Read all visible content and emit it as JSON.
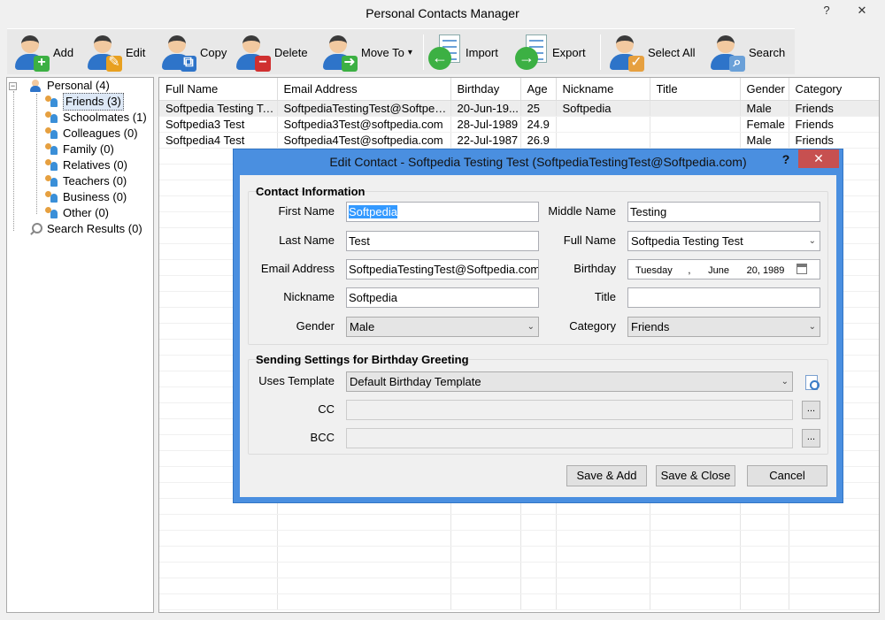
{
  "window": {
    "title": "Personal Contacts Manager",
    "help_glyph": "?",
    "close_glyph": "✕"
  },
  "toolbar": {
    "add": "Add",
    "edit": "Edit",
    "copy": "Copy",
    "delete": "Delete",
    "move_to": "Move To",
    "move_to_arrow": "▾",
    "import": "Import",
    "export": "Export",
    "select_all": "Select All",
    "search": "Search"
  },
  "tree": {
    "expander": "−",
    "root": "Personal (4)",
    "items": [
      "Friends (3)",
      "Schoolmates (1)",
      "Colleagues (0)",
      "Family (0)",
      "Relatives (0)",
      "Teachers (0)",
      "Business (0)",
      "Other (0)"
    ],
    "search_results": "Search Results (0)"
  },
  "grid": {
    "columns": [
      "Full Name",
      "Email Address",
      "Birthday",
      "Age",
      "Nickname",
      "Title",
      "Gender",
      "Category"
    ],
    "rows": [
      [
        "Softpedia  Testing  Test",
        "SoftpediaTestingTest@Softpedi...",
        "20-Jun-19...",
        "25",
        "Softpedia",
        "",
        "Male",
        "Friends"
      ],
      [
        "Softpedia3   Test",
        "Softpedia3Test@softpedia.com",
        "28-Jul-1989",
        "24.9",
        "",
        "",
        "Female",
        "Friends"
      ],
      [
        "Softpedia4   Test",
        "Softpedia4Test@softpedia.com",
        "22-Jul-1987",
        "26.9",
        "",
        "",
        "Male",
        "Friends"
      ]
    ]
  },
  "dialog": {
    "title": "Edit Contact - Softpedia Testing Test (SoftpediaTestingTest@Softpedia.com)",
    "help": "?",
    "close": "✕",
    "contact_section": "Contact Information",
    "labels": {
      "first_name": "First Name",
      "middle_name": "Middle Name",
      "last_name": "Last Name",
      "full_name": "Full Name",
      "email": "Email Address",
      "birthday": "Birthday",
      "nickname": "Nickname",
      "title": "Title",
      "gender": "Gender",
      "category": "Category"
    },
    "values": {
      "first_name": "Softpedia",
      "middle_name": "Testing",
      "last_name": "Test",
      "full_name": "Softpedia Testing Test",
      "email": "SoftpediaTestingTest@Softpedia.com",
      "birthday_weekday": "Tuesday",
      "birthday_sep": ",",
      "birthday_month": "June",
      "birthday_day_year": "20, 1989",
      "nickname": "Softpedia",
      "title": "",
      "gender": "Male",
      "category": "Friends"
    },
    "greeting_section": "Sending Settings for Birthday Greeting",
    "greeting_labels": {
      "uses_template": "Uses Template",
      "cc": "CC",
      "bcc": "BCC"
    },
    "greeting_values": {
      "template": "Default Birthday Template",
      "cc": "",
      "bcc": "",
      "browse": "..."
    },
    "buttons": {
      "save_add": "Save & Add",
      "save_close": "Save & Close",
      "cancel": "Cancel"
    },
    "dropdown_arrow": "⌄"
  }
}
